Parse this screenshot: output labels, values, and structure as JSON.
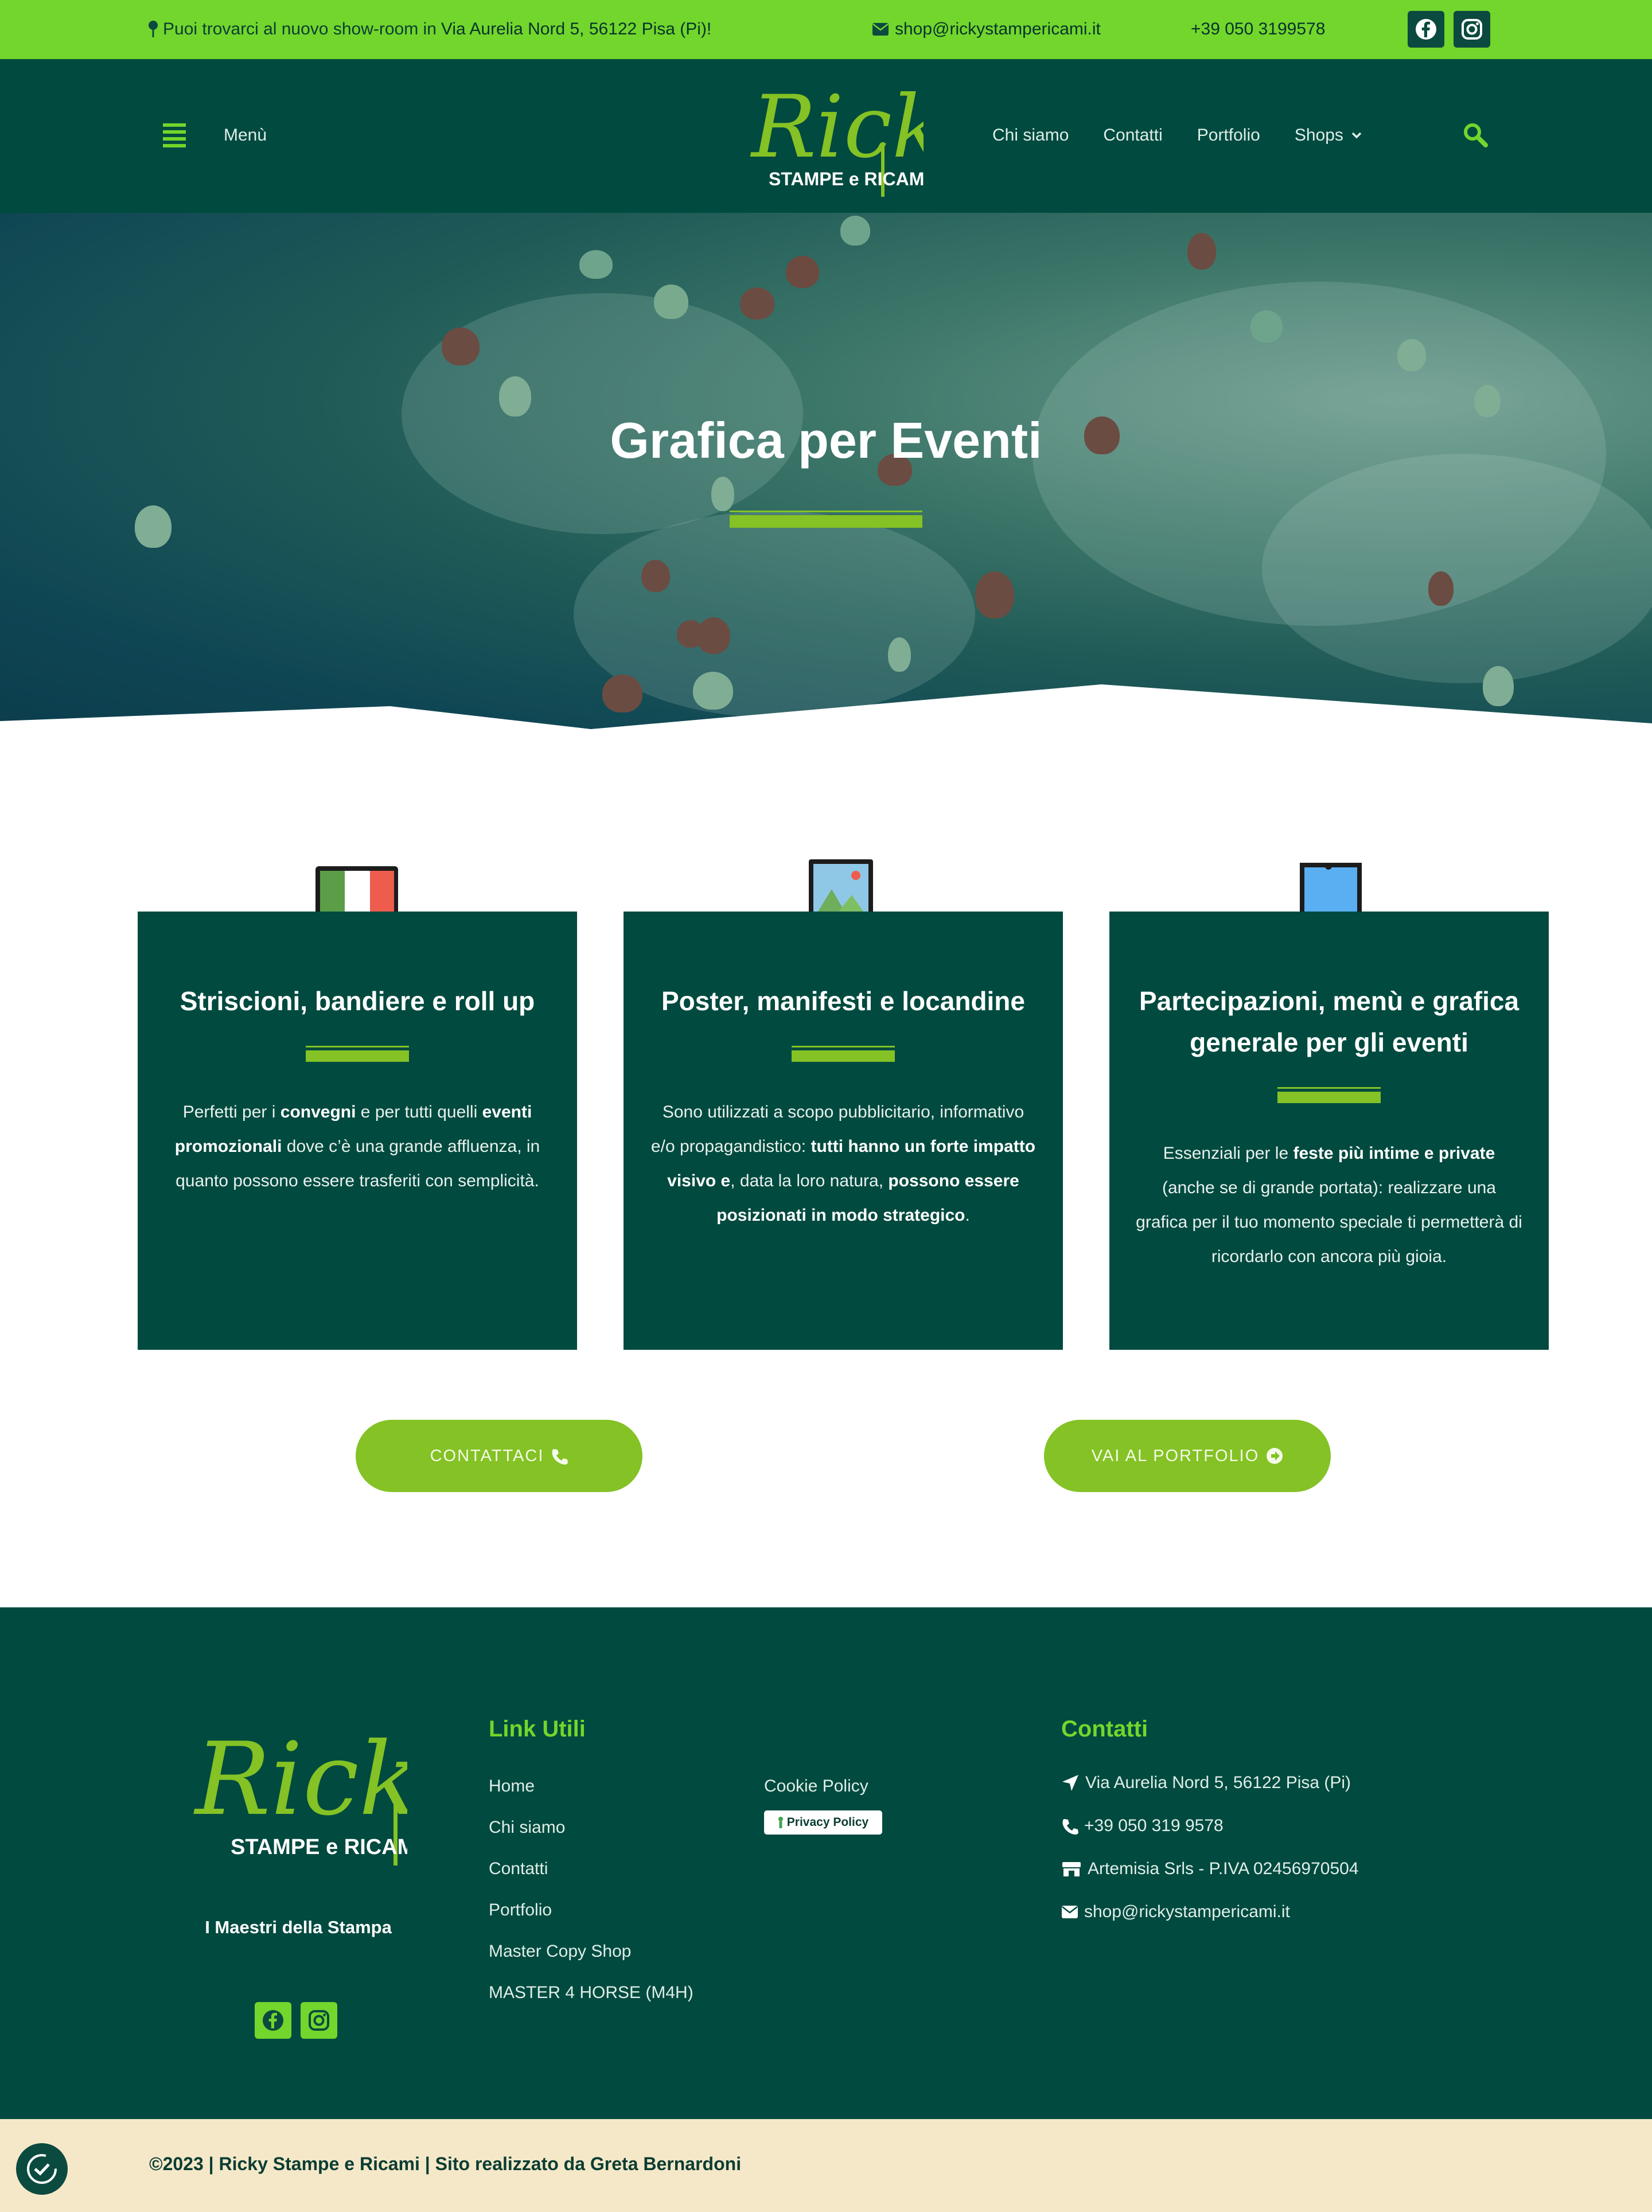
{
  "topbar": {
    "address_prefix": "Puoi trovarci al nuovo show-room in ",
    "address_bold": "Via Aurelia Nord 5, 56122 Pisa (Pi)!",
    "email": "shop@rickystampericami.it",
    "phone": "+39 050 3199578",
    "social": [
      "facebook-icon",
      "instagram-icon"
    ]
  },
  "header": {
    "menu_label": "Menù",
    "logo_text": "Ricky",
    "logo_subtext": "STAMPE e RICAMI",
    "nav": [
      "Chi siamo",
      "Contatti",
      "Portfolio",
      "Shops"
    ]
  },
  "hero": {
    "title": "Grafica per Eventi"
  },
  "cards": [
    {
      "icon": "italy-flag-icon",
      "title": "Striscioni, bandiere e roll up",
      "t1": "Perfetti per i ",
      "b1": "convegni",
      "t2": " e per tutti quelli ",
      "b2": "eventi promozionali",
      "t3": " dove c’è una grande affluenza, in quanto possono essere trasferiti con semplicità."
    },
    {
      "icon": "image-photo-icon",
      "title": "Poster, manifesti e locandine",
      "t1": "Sono utilizzati a scopo pubblicitario, informativo e/o propagandistico: ",
      "b1": "tutti hanno un forte impatto visivo e",
      "t2": ", data la loro natura, ",
      "b2": "possono essere posizionati in modo strategico",
      "t3": "."
    },
    {
      "icon": "document-note-icon",
      "title": "Partecipazioni, menù e grafica generale per gli eventi",
      "t1": "Essenziali per le ",
      "b1": "feste più intime e private",
      "t2": " (anche se di grande portata): realizzare una grafica per il tuo momento speciale ti permetterà di ricordarlo con ancora più gioia.",
      "b2": "",
      "t3": ""
    }
  ],
  "buttons": {
    "contact": "CONTATTACI",
    "portfolio": "VAI AL PORTFOLIO"
  },
  "footer": {
    "tagline": "I Maestri della Stampa",
    "links_heading": "Link Utili",
    "links": [
      "Home",
      "Chi siamo",
      "Contatti",
      "Portfolio",
      "Master Copy Shop",
      "MASTER 4 HORSE (M4H)"
    ],
    "links_secondary": [
      "Cookie Policy"
    ],
    "privacy_badge": "Privacy Policy",
    "contacts_heading": "Contatti",
    "contacts": {
      "address": "Via Aurelia Nord 5, 56122 Pisa (Pi)",
      "phone": "+39 050 319 9578",
      "company": "Artemisia Srls - P.IVA 02456970504",
      "email": "shop@rickystampericami.it"
    }
  },
  "bottom": {
    "copyright": "©2023 | Ricky Stampe e Ricami | Sito realizzato da Greta Bernardoni"
  },
  "colors": {
    "accent_green": "#72d62c",
    "brand_dark": "#004a3f",
    "button_green": "#84c225",
    "bottom_bar": "#f5e8c8"
  }
}
